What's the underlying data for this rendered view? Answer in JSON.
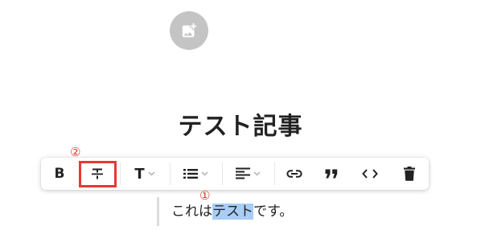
{
  "editor": {
    "add_image_icon": "add-photo-icon",
    "title": "テスト記事",
    "paragraph": {
      "before": "これは",
      "selected": "テスト",
      "after": "です。"
    }
  },
  "toolbar": {
    "buttons": [
      {
        "name": "bold",
        "label": "B"
      },
      {
        "name": "strikethrough",
        "icon": "strikethrough-icon"
      },
      {
        "name": "heading",
        "label": "T",
        "dropdown": true
      },
      {
        "name": "list",
        "icon": "bulleted-list-icon",
        "dropdown": true
      },
      {
        "name": "align",
        "icon": "align-left-icon",
        "dropdown": true
      },
      {
        "name": "link",
        "icon": "link-icon"
      },
      {
        "name": "quote",
        "icon": "quote-icon"
      },
      {
        "name": "code",
        "icon": "code-icon"
      },
      {
        "name": "delete",
        "icon": "trash-icon"
      }
    ]
  },
  "annotations": {
    "marker_1": "①",
    "marker_2": "②",
    "color": "#e53935"
  },
  "colors": {
    "selection": "#a9cdf5",
    "add_image_circle": "#c4c4c4"
  }
}
